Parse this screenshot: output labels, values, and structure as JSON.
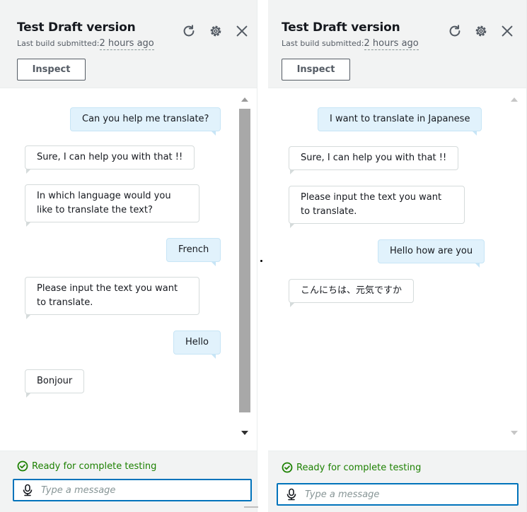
{
  "colors": {
    "accent": "#0073bb",
    "success": "#1d8102",
    "user_bubble": "#e1f2fc"
  },
  "icons": {
    "refresh": "refresh-icon",
    "settings": "gear-icon",
    "close": "close-icon",
    "check": "check-circle-icon",
    "mic": "microphone-icon"
  },
  "left": {
    "title": "Test Draft version",
    "subtitle_prefix": "Last build submitted:",
    "subtitle_link": "2 hours ago",
    "inspect_label": "Inspect",
    "messages": [
      {
        "role": "user",
        "text": "Can you help me translate?"
      },
      {
        "role": "bot",
        "text": "Sure, I can help you with that !!"
      },
      {
        "role": "bot",
        "text": "In which language would you like to translate the text?"
      },
      {
        "role": "user",
        "text": "French"
      },
      {
        "role": "bot",
        "text": "Please input the text you want to translate."
      },
      {
        "role": "user",
        "text": "Hello"
      },
      {
        "role": "bot",
        "text": "Bonjour"
      }
    ],
    "status": "Ready for complete testing",
    "input_placeholder": "Type a message"
  },
  "right": {
    "title": "Test Draft version",
    "subtitle_prefix": "Last build submitted:",
    "subtitle_link": "2 hours ago",
    "inspect_label": "Inspect",
    "messages": [
      {
        "role": "user",
        "text": "I want to translate in Japanese"
      },
      {
        "role": "bot",
        "text": "Sure, I can help you with that !!"
      },
      {
        "role": "bot",
        "text": "Please input the text you want to translate."
      },
      {
        "role": "user",
        "text": "Hello how are you"
      },
      {
        "role": "bot",
        "text": "こんにちは、元気ですか"
      }
    ],
    "status": "Ready for complete testing",
    "input_placeholder": "Type a message"
  }
}
